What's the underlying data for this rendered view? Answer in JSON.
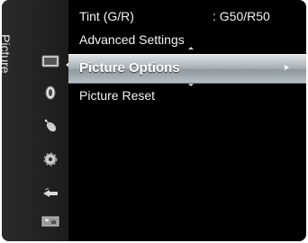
{
  "menu": {
    "title": "Picture"
  },
  "sidebar": {
    "icons": [
      "picture-icon",
      "sound-icon",
      "channel-icon",
      "setup-icon",
      "input-icon",
      "application-icon"
    ],
    "active_index": 0
  },
  "content": {
    "tint": {
      "label": "Tint (G/R)",
      "value": ": G50/R50"
    },
    "advanced": {
      "label": "Advanced Settings"
    },
    "picture_options": {
      "label": "Picture Options"
    },
    "picture_reset": {
      "label": "Picture Reset"
    }
  },
  "colors": {
    "highlight": "#a9b2b8",
    "text": "#f2f2f2",
    "background": "#000000"
  }
}
